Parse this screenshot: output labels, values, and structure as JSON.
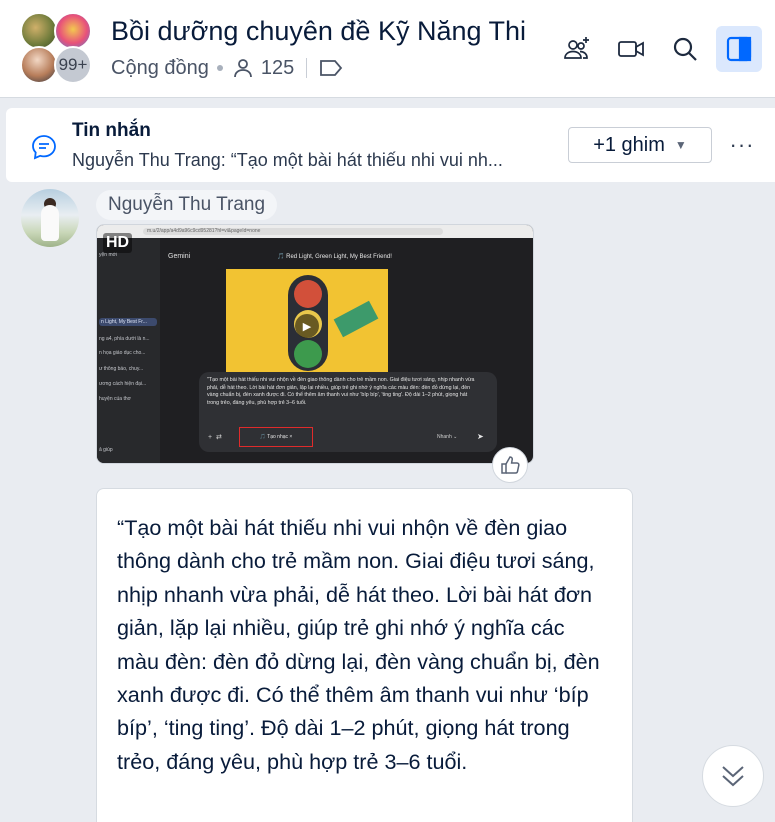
{
  "header": {
    "title": "Bồi dưỡng chuyên đề Kỹ Năng Thi",
    "type": "Cộng đồng",
    "member_count": "125",
    "avatar_overflow": "99+",
    "icons": [
      "add-member-icon",
      "video-call-icon",
      "search-icon",
      "side-panel-icon"
    ]
  },
  "pinned": {
    "title": "Tin nhắn",
    "preview": "Nguyễn Thu Trang: “Tạo một bài hát thiếu nhi vui nh...",
    "pin_button": "+1 ghim",
    "more": "···"
  },
  "message": {
    "sender": "Nguyễn Thu Trang",
    "video": {
      "badge": "HD",
      "app_title": "Gemini",
      "song_title": "🎵 Red Light, Green Light, My Best Friend!",
      "url": "m.u/2/app/a4d9a96c9cd95281?hl=vi&pageId=none",
      "sidebar_items": [
        "yện mới",
        "n Light, My Best Fr...",
        "ng a4, phía dưới là n...",
        "n họa giáo dục cho...",
        "ư thông báo, chuy...",
        "ương cách hiện đại...",
        "huyện của thơ",
        "ả giúp"
      ],
      "prompt": "\"Tạo một bài hát thiếu nhi vui nhộn về đèn giao thông dành cho trẻ mầm non. Giai điệu tươi sáng, nhịp nhanh vừa phải, dễ hát theo. Lời bài hát đơn giản, lặp lại nhiều, giúp trẻ ghi nhớ ý nghĩa các màu đèn: đèn đỏ dừng lại, đèn vàng chuẩn bị, đèn xanh được đi. Có thể thêm âm thanh vui như 'bíp bíp', 'ting ting'. Độ dài 1–2 phút, giọng hát trong trẻo, đáng yêu, phù hợp trẻ 3–6 tuổi.",
      "chip": "🎵 Tạo nhạc ×",
      "mode": "Nhanh ⌄",
      "footer": "Gemini là AI và có thể mắc sai sót."
    },
    "text": "“Tạo một bài hát thiếu nhi vui nhộn về đèn giao thông dành cho trẻ mầm non. Giai điệu tươi sáng, nhịp nhanh vừa phải, dễ hát theo. Lời bài hát đơn giản, lặp lại nhiều, giúp trẻ ghi nhớ ý nghĩa các màu đèn: đèn đỏ dừng lại, đèn vàng chuẩn bị, đèn xanh được đi. Có thể thêm âm thanh vui như ‘bíp bíp’, ‘ting ting’. Độ dài 1–2 phút, giọng hát trong trẻo, đáng yêu, phù hợp trẻ 3–6 tuổi."
  },
  "colors": {
    "accent": "#0068ff",
    "panel_active_bg": "#dbe8fd",
    "background": "#e9ecf1"
  }
}
